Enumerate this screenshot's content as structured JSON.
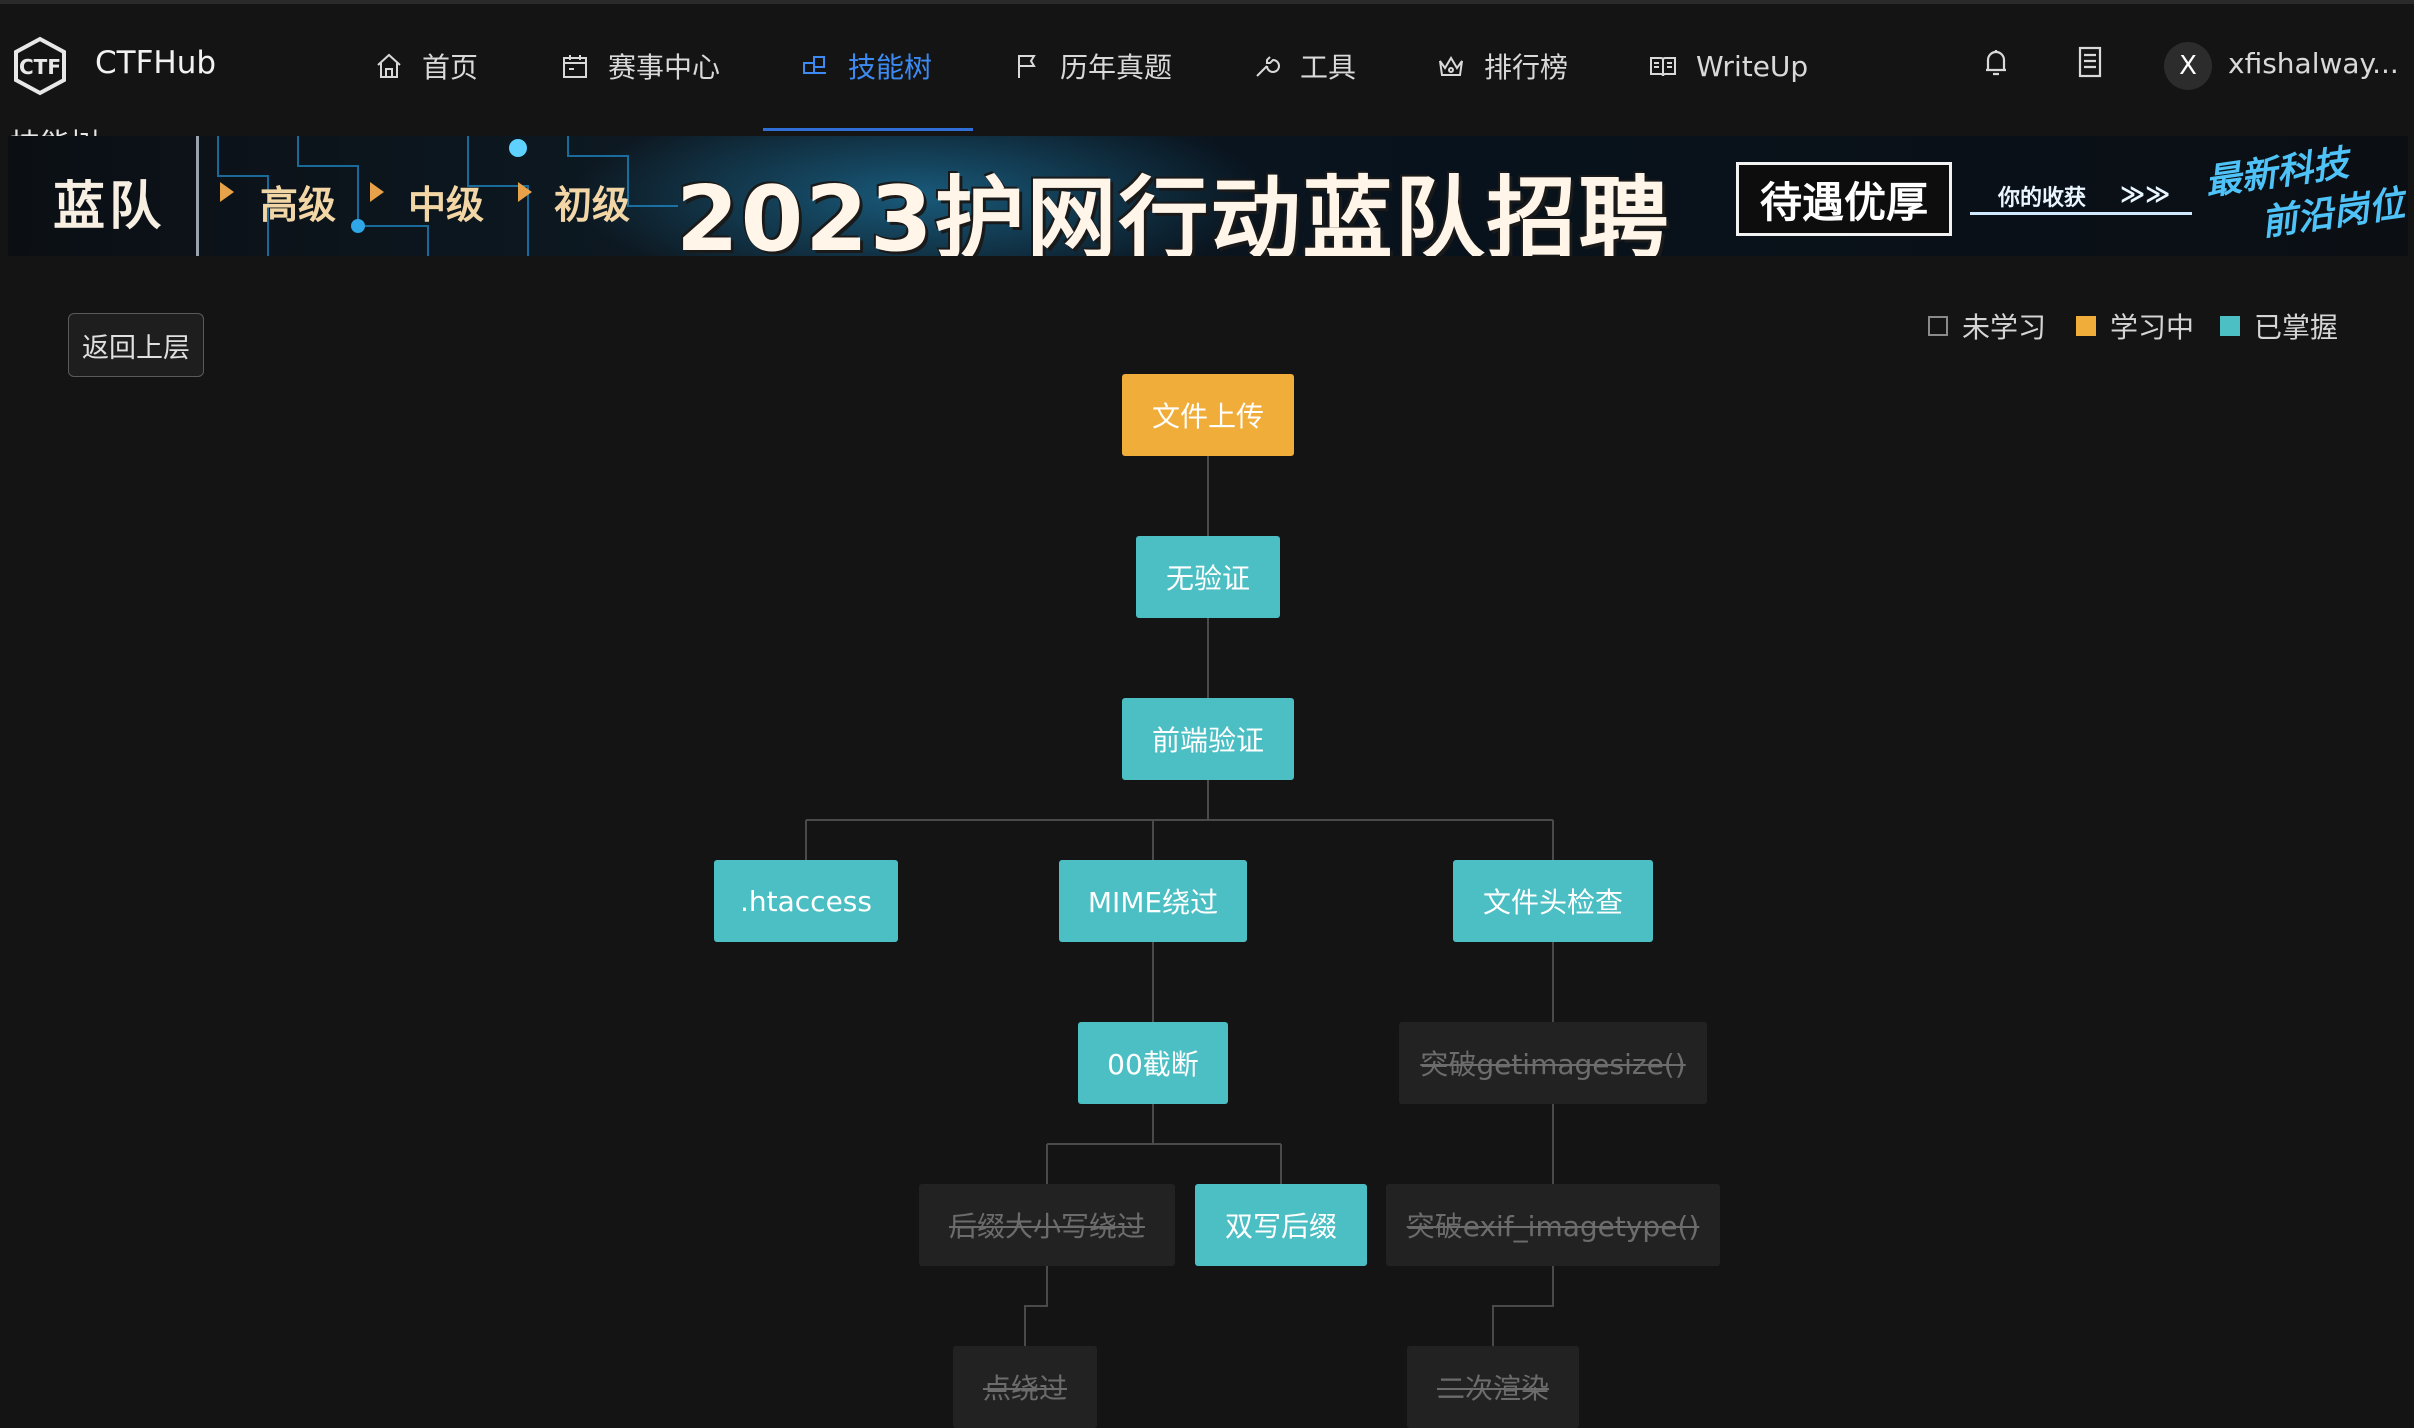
{
  "header": {
    "brand": "CTFHub",
    "nav": [
      {
        "label": "首页",
        "icon": "home-icon"
      },
      {
        "label": "赛事中心",
        "icon": "calendar-icon"
      },
      {
        "label": "技能树",
        "icon": "skill-tree-icon",
        "active": true
      },
      {
        "label": "历年真题",
        "icon": "flag-icon"
      },
      {
        "label": "工具",
        "icon": "wrench-icon"
      },
      {
        "label": "排行榜",
        "icon": "crown-icon"
      },
      {
        "label": "WriteUp",
        "icon": "book-icon"
      }
    ],
    "user_initial": "X",
    "username": "xfishalway...",
    "page_heading": "技能树"
  },
  "banner": {
    "team": "蓝队",
    "levels": [
      "高级",
      "中级",
      "初级"
    ],
    "title": "2023护网行动蓝队招聘",
    "badge": "待遇优厚",
    "small_text": "你的收获",
    "chevrons": "≫≫",
    "new_line1": "最新科技",
    "new_line2": "前沿岗位"
  },
  "main": {
    "back_label": "返回上层",
    "legend": [
      {
        "label": "未学习",
        "color": "#141414",
        "border": "#8a8a8a"
      },
      {
        "label": "学习中",
        "color": "#f0ad3a"
      },
      {
        "label": "已掌握",
        "color": "#4bbfc3"
      }
    ]
  },
  "tree": {
    "nodes": [
      {
        "id": "upload",
        "label": "文件上传",
        "status": "learning"
      },
      {
        "id": "noverify",
        "label": "无验证",
        "status": "mastered"
      },
      {
        "id": "frontend",
        "label": "前端验证",
        "status": "mastered"
      },
      {
        "id": "htaccess",
        "label": ".htaccess",
        "status": "mastered"
      },
      {
        "id": "mime",
        "label": "MIME绕过",
        "status": "mastered"
      },
      {
        "id": "header",
        "label": "文件头检查",
        "status": "mastered"
      },
      {
        "id": "null",
        "label": "00截断",
        "status": "mastered"
      },
      {
        "id": "getimagesize",
        "label": "突破getimagesize()",
        "status": "notlearned"
      },
      {
        "id": "case",
        "label": "后缀大小写绕过",
        "status": "notlearned"
      },
      {
        "id": "double",
        "label": "双写后缀",
        "status": "mastered"
      },
      {
        "id": "exif",
        "label": "突破exif_imagetype()",
        "status": "notlearned"
      },
      {
        "id": "dot",
        "label": "点绕过",
        "status": "notlearned"
      },
      {
        "id": "render",
        "label": "二次渲染",
        "status": "notlearned"
      }
    ],
    "edges": [
      [
        "upload",
        "noverify"
      ],
      [
        "noverify",
        "frontend"
      ],
      [
        "frontend",
        "htaccess"
      ],
      [
        "frontend",
        "mime"
      ],
      [
        "frontend",
        "header"
      ],
      [
        "mime",
        "null"
      ],
      [
        "header",
        "getimagesize"
      ],
      [
        "null",
        "case"
      ],
      [
        "null",
        "double"
      ],
      [
        "getimagesize",
        "exif"
      ],
      [
        "case",
        "dot"
      ],
      [
        "exif",
        "render"
      ]
    ]
  }
}
